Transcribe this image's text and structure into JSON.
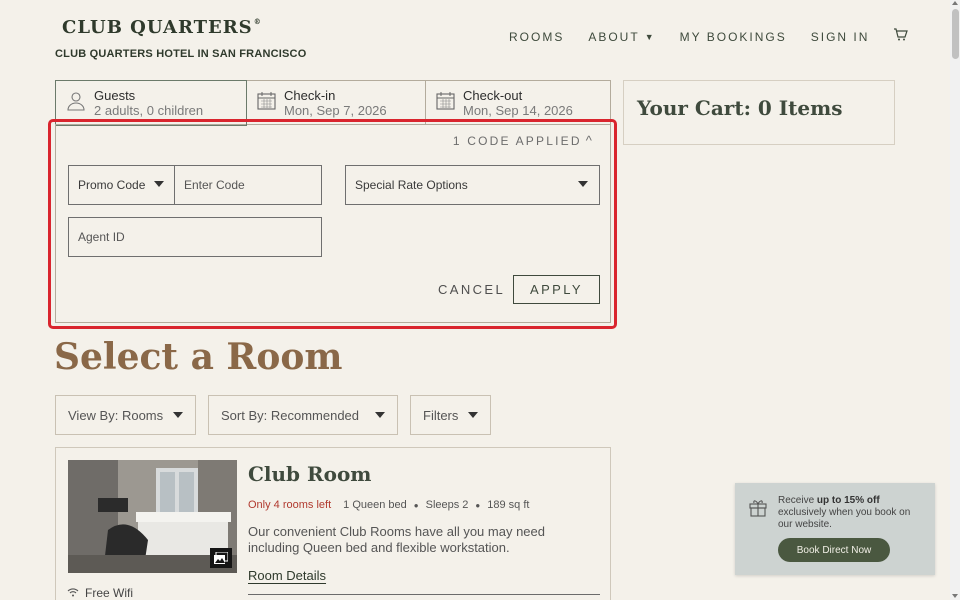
{
  "header": {
    "logo": "CLUB QUARTERS",
    "logo_mark": "®",
    "hotel_name": "CLUB QUARTERS HOTEL IN SAN FRANCISCO",
    "nav": [
      "ROOMS",
      "ABOUT",
      "MY BOOKINGS",
      "SIGN IN"
    ],
    "cart_icon": "cart-icon"
  },
  "booking": {
    "guests_label": "Guests",
    "guests_value": "2 adults, 0 children",
    "checkin_label": "Check-in",
    "checkin_value": "Mon, Sep 7, 2026",
    "checkout_label": "Check-out",
    "checkout_value": "Mon, Sep 14, 2026"
  },
  "promo": {
    "codes_applied": "1 CODE APPLIED",
    "code_type": "Promo Code",
    "code_placeholder": "Enter Code",
    "rate_options": "Special Rate Options",
    "agent_placeholder": "Agent ID",
    "cancel": "CANCEL",
    "apply": "APPLY"
  },
  "cart": {
    "title": "Your Cart: 0 Items"
  },
  "rooms": {
    "heading": "Select a Room",
    "view_by": "View By: Rooms",
    "sort_by": "Sort By: Recommended",
    "filters": "Filters",
    "card": {
      "name": "Club Room",
      "availability": "Only 4 rooms left",
      "bed": "1 Queen bed",
      "sleeps": "Sleeps 2",
      "size": "189 sq ft",
      "description": "Our convenient Club Rooms have all you may need including Queen bed and flexible workstation.",
      "details_link": "Room Details",
      "amenity": "Free Wifi"
    }
  },
  "toast": {
    "text_before": "Receive ",
    "text_bold": "up to 15% off",
    "text_after": " exclusively when you book on our website.",
    "button": "Book Direct Now"
  },
  "colors": {
    "background": "#f4f1ea",
    "accent_green": "#3f4a3d",
    "heading_brown": "#8a6848",
    "highlight_red": "#d9252e",
    "availability_red": "#b13a2f"
  }
}
